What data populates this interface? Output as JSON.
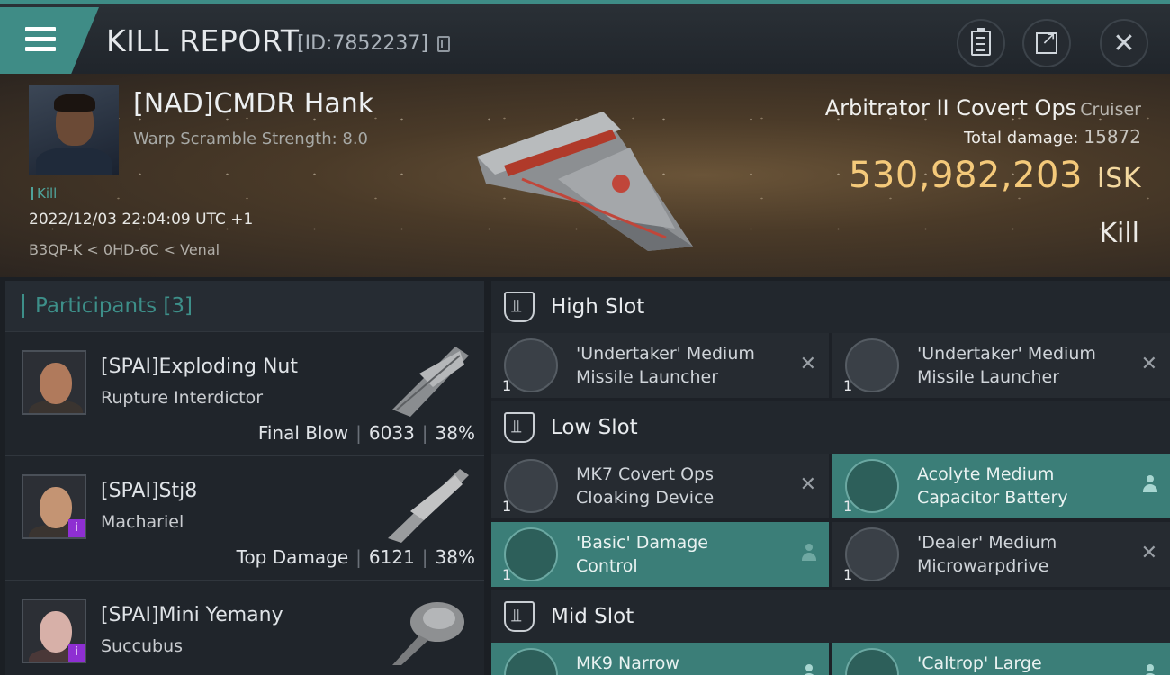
{
  "header": {
    "title": "KILL REPORT",
    "report_id": "[ID:7852237]"
  },
  "victim": {
    "name": "[NAD]CMDR Hank",
    "warp_scramble": "Warp Scramble Strength: 8.0",
    "tag": "Kill",
    "datetime": "2022/12/03 22:04:09 UTC +1",
    "location": "B3QP-K < 0HD-6C < Venal",
    "ship_name": "Arbitrator II Covert Ops",
    "ship_class": "Cruiser",
    "total_damage_label": "Total damage:",
    "total_damage": "15872",
    "isk_value": "530,982,203",
    "isk_unit": "ISK",
    "result": "Kill"
  },
  "participants": {
    "title": "Participants",
    "count": "[3]",
    "list": [
      {
        "name": "[SPAI]Exploding Nut",
        "ship": "Rupture Interdictor",
        "role": "Final Blow",
        "damage": "6033",
        "percent": "38%"
      },
      {
        "name": "[SPAI]Stj8",
        "ship": "Machariel",
        "role": "Top Damage",
        "damage": "6121",
        "percent": "38%"
      },
      {
        "name": "[SPAI]Mini Yemany",
        "ship": "Succubus",
        "role": "",
        "damage": "",
        "percent": ""
      }
    ]
  },
  "slots": {
    "high": {
      "title": "High Slot",
      "items": [
        {
          "name_line1": "'Undertaker' Medium",
          "name_line2": "Missile Launcher",
          "qty": "1",
          "state": "destroyed"
        },
        {
          "name_line1": "'Undertaker' Medium",
          "name_line2": "Missile Launcher",
          "qty": "1",
          "state": "destroyed"
        }
      ]
    },
    "low": {
      "title": "Low Slot",
      "items": [
        {
          "name_line1": "MK7 Covert Ops",
          "name_line2": "Cloaking Device",
          "qty": "1",
          "state": "destroyed"
        },
        {
          "name_line1": "Acolyte Medium",
          "name_line2": "Capacitor Battery",
          "qty": "1",
          "state": "dropped"
        },
        {
          "name_line1": "'Basic' Damage",
          "name_line2": "Control",
          "qty": "1",
          "state": "dropped"
        },
        {
          "name_line1": "'Dealer' Medium",
          "name_line2": "Microwarpdrive",
          "qty": "1",
          "state": "destroyed"
        }
      ]
    },
    "mid": {
      "title": "Mid Slot",
      "items": [
        {
          "name_line1": "MK9 Narrow",
          "qty": "1",
          "state": "dropped"
        },
        {
          "name_line1": "'Caltrop' Large",
          "qty": "1",
          "state": "dropped"
        }
      ]
    }
  },
  "colors": {
    "accent": "#3f8c86",
    "isk": "#f4c97a",
    "dropped_bg": "#3b7e78"
  }
}
